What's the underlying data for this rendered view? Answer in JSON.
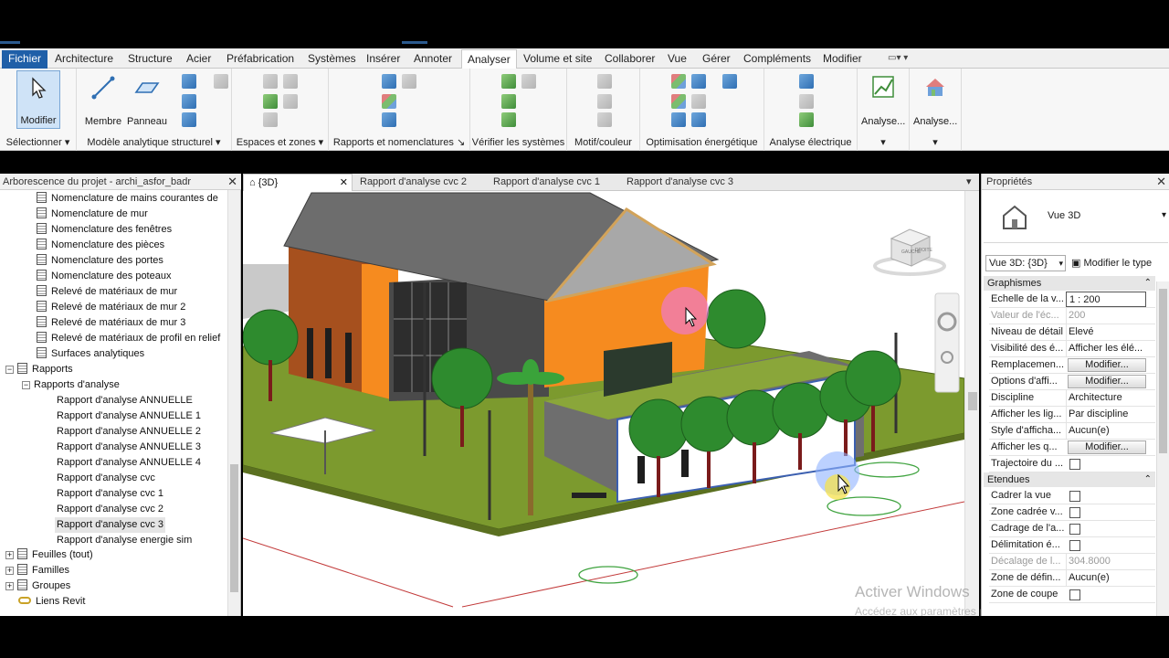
{
  "ribbon": {
    "tabs": [
      "Fichier",
      "Architecture",
      "Structure",
      "Acier",
      "Préfabrication",
      "Systèmes",
      "Insérer",
      "Annoter",
      "Analyser",
      "Volume et site",
      "Collaborer",
      "Vue",
      "Gérer",
      "Compléments",
      "Modifier"
    ],
    "active_tab": "Analyser",
    "buttons": {
      "modifier": "Modifier",
      "membre": "Membre",
      "panneau": "Panneau",
      "analyse1": "Analyse...",
      "analyse2": "Analyse..."
    },
    "panels": {
      "select": "Sélectionner",
      "analytical": "Modèle analytique structurel",
      "spaces": "Espaces et zones",
      "reports": "Rapports et nomenclatures",
      "verify": "Vérifier les systèmes",
      "pattern": "Motif/couleur",
      "energy": "Optimisation énergétique",
      "electric": "Analyse électrique"
    }
  },
  "browser": {
    "title": "Arborescence du projet - archi_asfor_badr",
    "items": [
      "Nomenclature de mains courantes de",
      "Nomenclature de mur",
      "Nomenclature des fenêtres",
      "Nomenclature des pièces",
      "Nomenclature des portes",
      "Nomenclature des poteaux",
      "Relevé de matériaux de mur",
      "Relevé de matériaux de mur 2",
      "Relevé de matériaux de mur 3",
      "Relevé de matériaux de profil en relief",
      "Surfaces analytiques"
    ],
    "rapports": "Rapports",
    "rapports_analyse": "Rapports d'analyse",
    "reports": [
      "Rapport d'analyse ANNUELLE",
      "Rapport d'analyse ANNUELLE 1",
      "Rapport d'analyse ANNUELLE 2",
      "Rapport d'analyse ANNUELLE 3",
      "Rapport d'analyse ANNUELLE 4",
      "Rapport d'analyse cvc",
      "Rapport d'analyse cvc 1",
      "Rapport d'analyse cvc 2",
      "Rapport d'analyse cvc 3",
      "Rapport d'analyse energie sim"
    ],
    "bottom": [
      "Feuilles (tout)",
      "Familles",
      "Groupes",
      "Liens Revit"
    ]
  },
  "views": {
    "tabs": [
      "{3D}",
      "Rapport d'analyse cvc 2",
      "Rapport d'analyse cvc 1",
      "Rapport d'analyse cvc 3"
    ],
    "viewcube": {
      "left": "GAUCHE",
      "front": "DROITE"
    }
  },
  "watermark": {
    "line1": "Activer Windows",
    "line2": "Accédez aux paramètres pour activer Windo"
  },
  "properties": {
    "title": "Propriétés",
    "type_name": "Vue 3D",
    "view_selector": "Vue 3D: {3D}",
    "modify_type": "Modifier le type",
    "groups": {
      "graphics": "Graphismes",
      "extents": "Etendues"
    },
    "rows": [
      {
        "name": "Echelle de la v...",
        "value": "1 : 200"
      },
      {
        "name": "Valeur de l'éc...",
        "value": "200"
      },
      {
        "name": "Niveau de détail",
        "value": "Elevé"
      },
      {
        "name": "Visibilité des é...",
        "value": "Afficher les élé..."
      },
      {
        "name": "Remplacemen...",
        "value": "Modifier..."
      },
      {
        "name": "Options d'affi...",
        "value": "Modifier..."
      },
      {
        "name": "Discipline",
        "value": "Architecture"
      },
      {
        "name": "Afficher les lig...",
        "value": "Par discipline"
      },
      {
        "name": "Style d'afficha...",
        "value": "Aucun(e)"
      },
      {
        "name": "Afficher les q...",
        "value": "Modifier..."
      },
      {
        "name": "Trajectoire du ...",
        "value": ""
      }
    ],
    "extent_rows": [
      {
        "name": "Cadrer la vue",
        "value": ""
      },
      {
        "name": "Zone cadrée v...",
        "value": ""
      },
      {
        "name": "Cadrage de l'a...",
        "value": ""
      },
      {
        "name": "Délimitation é...",
        "value": ""
      },
      {
        "name": "Décalage de l...",
        "value": "304.8000"
      },
      {
        "name": "Zone de défin...",
        "value": "Aucun(e)"
      },
      {
        "name": "Zone de coupe",
        "value": ""
      }
    ]
  }
}
